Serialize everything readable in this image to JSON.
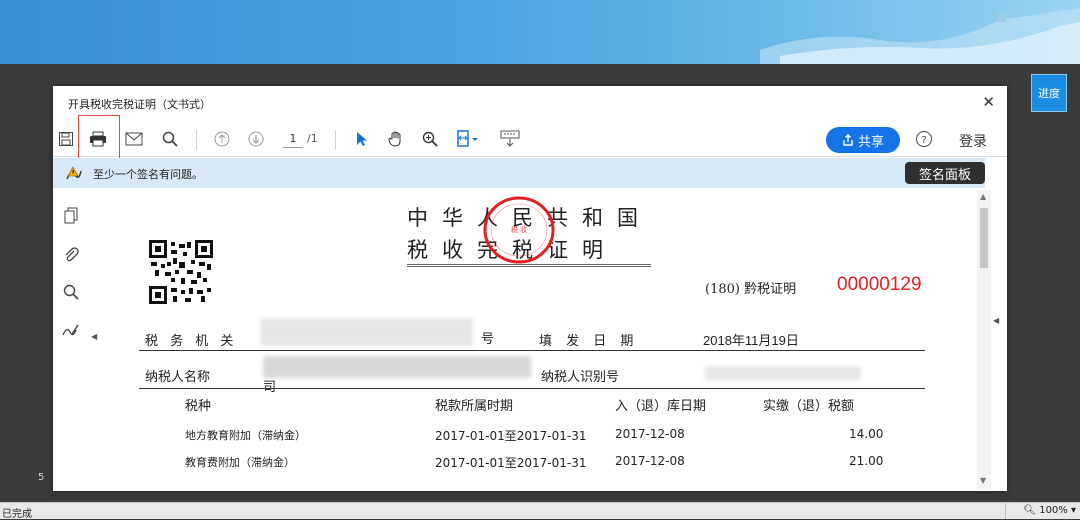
{
  "window": {
    "side_button": "进度"
  },
  "dialog": {
    "title": "开具税收完税证明（文书式）"
  },
  "toolbar": {
    "page_current": "1",
    "page_total": "/1",
    "share_label": "共享",
    "login_label": "登录"
  },
  "signature_bar": {
    "message": "至少一个签名有问题。",
    "panel_button": "签名面板"
  },
  "certificate": {
    "title_line1": "中华人民共和国",
    "title_line2": "税收完税证明",
    "number_prefix": "(180) 黔税证明",
    "number": "00000129",
    "tax_authority_label": "税 务 机 关",
    "tax_authority_suffix": "号",
    "issue_date_label": "填 发 日 期",
    "issue_date": "2018年11月19日",
    "taxpayer_name_label": "纳税人名称",
    "taxpayer_name_tail": "司",
    "taxpayer_id_label": "纳税人识别号",
    "columns": {
      "tax_type": "税种",
      "period": "税款所属时期",
      "storage_date": "入（退）库日期",
      "amount": "实缴（退）税额"
    },
    "rows": [
      {
        "tax_type": "地方教育附加（滞纳金）",
        "period": "2017-01-01至2017-01-31",
        "storage_date": "2017-12-08",
        "amount": "14.00"
      },
      {
        "tax_type": "教育费附加（滞纳金）",
        "period": "2017-01-01至2017-01-31",
        "storage_date": "2017-12-08",
        "amount": "21.00"
      }
    ]
  },
  "statusbar": {
    "status": "已完成",
    "zoom": "100%"
  },
  "colors": {
    "accent_blue": "#1473e6",
    "stamp_red": "#e02020",
    "signature_bar_bg": "#d7e9f7"
  }
}
